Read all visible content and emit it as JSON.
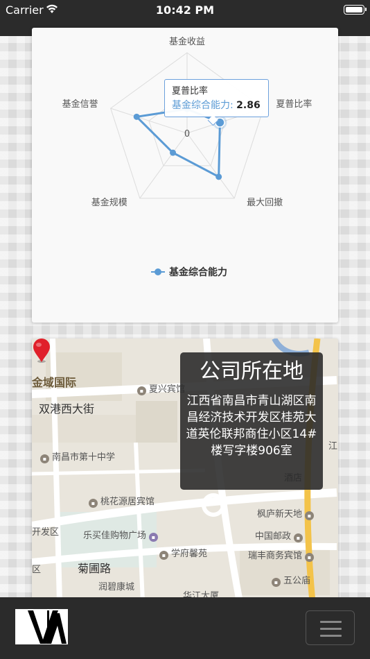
{
  "status_bar": {
    "carrier": "Carrier",
    "time": "10:42 PM"
  },
  "chart_data": {
    "type": "radar",
    "indicators": [
      "基金收益",
      "夏普比率",
      "最大回撤",
      "基金规模",
      "基金信誉"
    ],
    "series": [
      {
        "name": "基金综合能力",
        "values": [
          0.3,
          0.43,
          0.67,
          0.3,
          0.66
        ]
      }
    ],
    "center_label": "0",
    "legend": "bottom",
    "tooltip": {
      "title": "夏普比率",
      "series": "基金综合能力",
      "value": "2.86"
    }
  },
  "map": {
    "title": "公司所在地",
    "address": "江西省南昌市青山湖区南昌经济技术开发区桂苑大道英伦联邦商住小区14#楼写字楼906室",
    "labels": {
      "jinyu": "金域国际",
      "xiaxing": "夏兴宾馆",
      "shuanggang": "双港西大街",
      "school": "南昌市第十中学",
      "taohua": "桃花源居宾馆",
      "fengting": "枫庐新天地",
      "kaifa": "开发区",
      "lejia": "乐买佳购物广场",
      "youzheng": "中国邮政",
      "juwei": "菊圃路",
      "xuefu": "学府馨苑",
      "ruifeng": "瑞丰商务宾馆",
      "runbi": "润碧康城",
      "wugong": "五公庙",
      "huajiang": "华江大厦",
      "qu": "区",
      "jiang": "江",
      "hotel": "酒店"
    }
  },
  "colors": {
    "accent": "#5b9bd5",
    "bar": "#2b2b2b",
    "pin": "#e0202a"
  },
  "icons": {
    "wifi": "wifi-icon",
    "battery": "battery-icon",
    "menu": "hamburger-menu-icon",
    "pin": "map-pin-icon"
  }
}
